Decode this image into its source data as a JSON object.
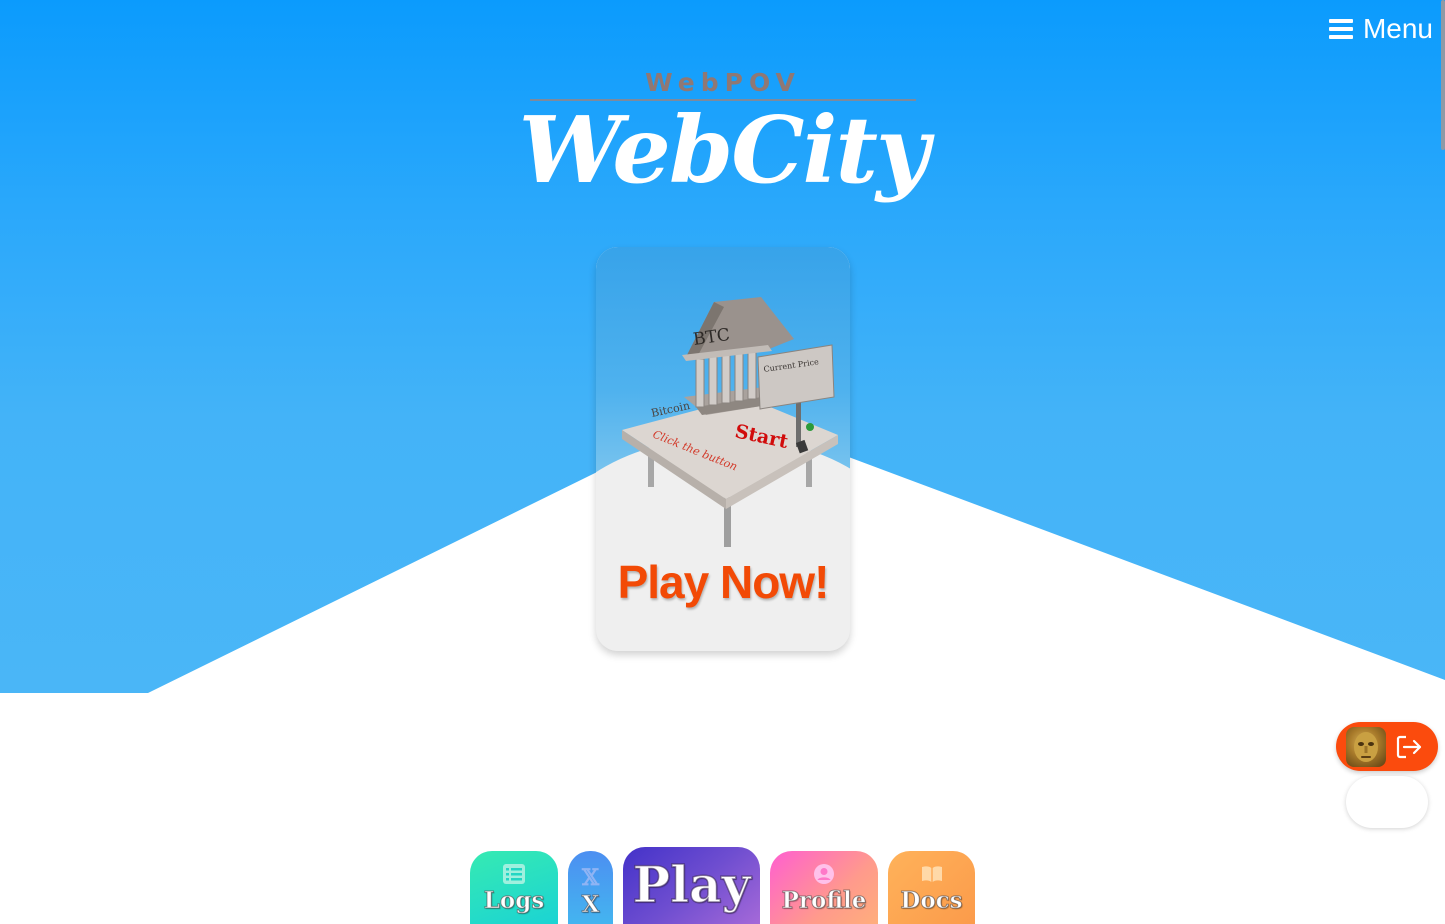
{
  "header": {
    "menu_label": "Menu",
    "menu_icon": "hamburger-icon"
  },
  "brand": {
    "subtitle": "WebPOV",
    "title": "WebCity"
  },
  "play_card": {
    "cta_label": "Play Now!",
    "image_texts": {
      "temple_sign": "BTC",
      "billboard": "Current Price",
      "platform_start": "Start",
      "platform_hint": "Click the button",
      "platform_left": "Bitcoin"
    }
  },
  "user_widget": {
    "avatar_icon": "golden-mask-avatar",
    "logout_icon": "logout-icon"
  },
  "bottom_nav": {
    "logs": {
      "label": "Logs",
      "icon": "list-icon"
    },
    "x": {
      "label": "X",
      "icon": "x-logo-icon",
      "icon_glyph": "𝕏"
    },
    "play": {
      "label": "Play"
    },
    "profile": {
      "label": "Profile",
      "icon": "user-icon"
    },
    "docs": {
      "label": "Docs",
      "icon": "book-icon"
    }
  },
  "colors": {
    "sky_top": "#0b9bfd",
    "sky_bottom": "#4ab6f7",
    "cta_orange": "#f24a06",
    "user_pill": "#fb4b0d"
  }
}
